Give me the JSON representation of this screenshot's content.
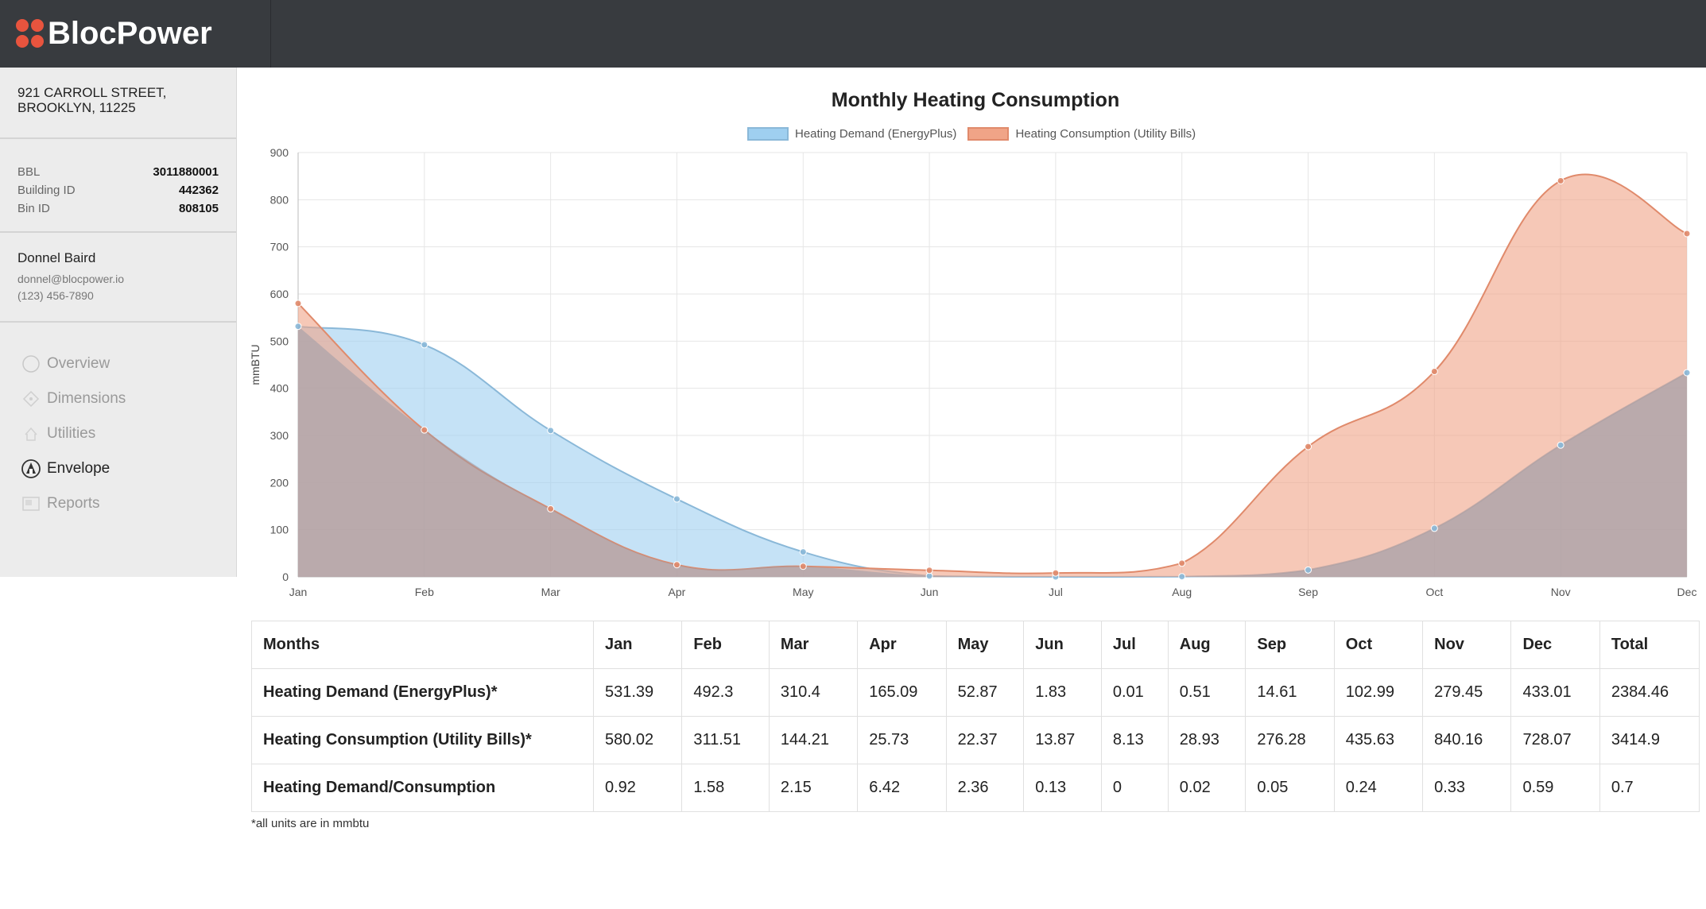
{
  "brand": {
    "name": "BlocPower",
    "accent": "#e8543e"
  },
  "sidebar": {
    "address": [
      "921 CARROLL STREET,",
      "BROOKLYN, 11225"
    ],
    "ids": [
      {
        "label": "BBL",
        "value": "3011880001"
      },
      {
        "label": "Building ID",
        "value": "442362"
      },
      {
        "label": "Bin ID",
        "value": "808105"
      }
    ],
    "contact": {
      "name": "Donnel Baird",
      "email": "donnel@blocpower.io",
      "phone": "(123) 456-7890"
    },
    "nav": [
      {
        "label": "Overview",
        "icon": "overview-icon",
        "active": false
      },
      {
        "label": "Dimensions",
        "icon": "dimensions-icon",
        "active": false
      },
      {
        "label": "Utilities",
        "icon": "utilities-icon",
        "active": false
      },
      {
        "label": "Envelope",
        "icon": "envelope-icon",
        "active": true
      },
      {
        "label": "Reports",
        "icon": "reports-icon",
        "active": false
      }
    ]
  },
  "chart_data": {
    "type": "area",
    "title": "Monthly Heating Consumption",
    "ylabel": "mmBTU",
    "xlabel": "",
    "ylim": [
      0,
      900
    ],
    "yticks": [
      0,
      100,
      200,
      300,
      400,
      500,
      600,
      700,
      800,
      900
    ],
    "grid": true,
    "legend_position": "top",
    "categories": [
      "Jan",
      "Feb",
      "Mar",
      "Apr",
      "May",
      "Jun",
      "Jul",
      "Aug",
      "Sep",
      "Oct",
      "Nov",
      "Dec"
    ],
    "series": [
      {
        "name": "Heating Demand (EnergyPlus)",
        "color": "#9fcff0",
        "stroke": "#8ab8d8",
        "values": [
          531.39,
          492.3,
          310.4,
          165.09,
          52.87,
          1.83,
          0.01,
          0.51,
          14.61,
          102.99,
          279.45,
          433.01
        ]
      },
      {
        "name": "Heating Consumption (Utility Bills)",
        "color": "#f0a487",
        "stroke": "#e08a6b",
        "values": [
          580.02,
          311.51,
          144.21,
          25.73,
          22.37,
          13.87,
          8.13,
          28.93,
          276.28,
          435.63,
          840.16,
          728.07
        ]
      }
    ]
  },
  "table": {
    "headers": [
      "Months",
      "Jan",
      "Feb",
      "Mar",
      "Apr",
      "May",
      "Jun",
      "Jul",
      "Aug",
      "Sep",
      "Oct",
      "Nov",
      "Dec",
      "Total"
    ],
    "rows": [
      [
        "Heating Demand (EnergyPlus)*",
        "531.39",
        "492.3",
        "310.4",
        "165.09",
        "52.87",
        "1.83",
        "0.01",
        "0.51",
        "14.61",
        "102.99",
        "279.45",
        "433.01",
        "2384.46"
      ],
      [
        "Heating Consumption (Utility Bills)*",
        "580.02",
        "311.51",
        "144.21",
        "25.73",
        "22.37",
        "13.87",
        "8.13",
        "28.93",
        "276.28",
        "435.63",
        "840.16",
        "728.07",
        "3414.9"
      ],
      [
        "Heating Demand/Consumption",
        "0.92",
        "1.58",
        "2.15",
        "6.42",
        "2.36",
        "0.13",
        "0",
        "0.02",
        "0.05",
        "0.24",
        "0.33",
        "0.59",
        "0.7"
      ]
    ]
  },
  "footnote": "*all units are in mmbtu"
}
